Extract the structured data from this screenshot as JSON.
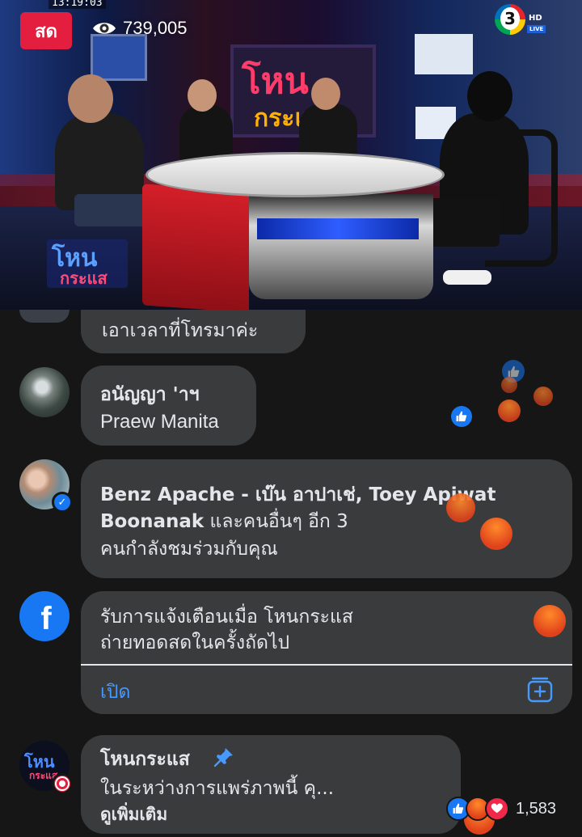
{
  "video": {
    "clock": "13:19:03",
    "live_label": "สด",
    "viewer_count": "739,005",
    "channel_logo": "3",
    "channel_hd": "HD",
    "channel_live": "LIVE",
    "screen_logo_line1": "โหน",
    "screen_logo_line2": "กระแส",
    "watermark_line1": "โหน",
    "watermark_line2": "กระแส"
  },
  "comments": [
    {
      "name": "",
      "text": "เอาเวลาที่โทรมาค่ะ"
    },
    {
      "name": "อนัญญา 'าฯ",
      "text": "Praew Manita"
    }
  ],
  "watching_notice": {
    "line1": "Benz Apache - เบ๊น อาปาเช่, Toey Apiwat",
    "line2_bold": "Boonanak",
    "line2_rest": " และคนอื่นๆ อีก 3",
    "line3": "คนกำลังชมร่วมกับคุณ"
  },
  "notify_card": {
    "line1": "รับการแจ้งเตือนเมื่อ โหนกระแส",
    "line2": "ถ่ายทอดสดในครั้งถัดไป",
    "open_label": "เปิด"
  },
  "pinned_comment": {
    "name": "โหนกระแส",
    "text": "ในระหว่างการแพร่ภาพนี้ คุ...",
    "see_more": "ดูเพิ่มเติม",
    "avatar_line1": "โหน",
    "avatar_line2": "กระแส"
  },
  "reactions": {
    "total": "1,583",
    "types": [
      "like-icon",
      "angry-icon",
      "love-icon"
    ]
  },
  "colors": {
    "live_red": "#e41e3f",
    "facebook_blue": "#1877f2",
    "link_blue": "#4599ff",
    "bubble": "#3a3b3c",
    "background": "#161616"
  }
}
